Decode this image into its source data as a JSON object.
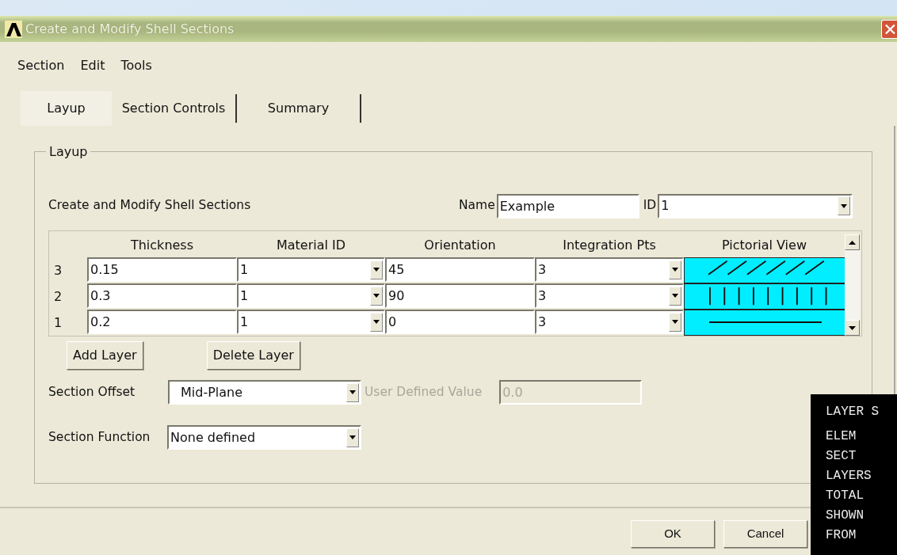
{
  "window": {
    "title": "Create and Modify Shell Sections"
  },
  "menu": [
    "Section",
    "Edit",
    "Tools"
  ],
  "tabs": [
    {
      "label": "Layup",
      "selected": true
    },
    {
      "label": "Section Controls",
      "selected": false
    },
    {
      "label": "Summary",
      "selected": false
    }
  ],
  "group": {
    "title": "Layup",
    "heading": "Create and Modify Shell Sections",
    "name_label": "Name",
    "name_value": "Example",
    "id_label": "ID",
    "id_value": "1"
  },
  "table": {
    "columns": [
      "Thickness",
      "Material ID",
      "Orientation",
      "Integration Pts",
      "Pictorial View"
    ],
    "rows": [
      {
        "layer": "3",
        "thickness": "0.15",
        "material_id": "1",
        "orientation": "45",
        "integration_pts": "3",
        "kind": "diagonal"
      },
      {
        "layer": "2",
        "thickness": "0.3",
        "material_id": "1",
        "orientation": "90",
        "integration_pts": "3",
        "kind": "vertical"
      },
      {
        "layer": "1",
        "thickness": "0.2",
        "material_id": "1",
        "orientation": "0",
        "integration_pts": "3",
        "kind": "horizontal"
      }
    ]
  },
  "layer_buttons": [
    "Add Layer",
    "Delete Layer"
  ],
  "section_offset": {
    "label": "Section Offset",
    "value": "Mid-Plane",
    "user_label": "User Defined Value",
    "user_value": "0.0",
    "disabled": true
  },
  "section_function": {
    "label": "Section Function",
    "value": "None defined"
  },
  "buttons": [
    "OK",
    "Cancel"
  ],
  "console": [
    "LAYER S",
    "ELEM",
    "SECT",
    "LAYERS",
    "TOTAL",
    "SHOWN",
    "FROM"
  ]
}
